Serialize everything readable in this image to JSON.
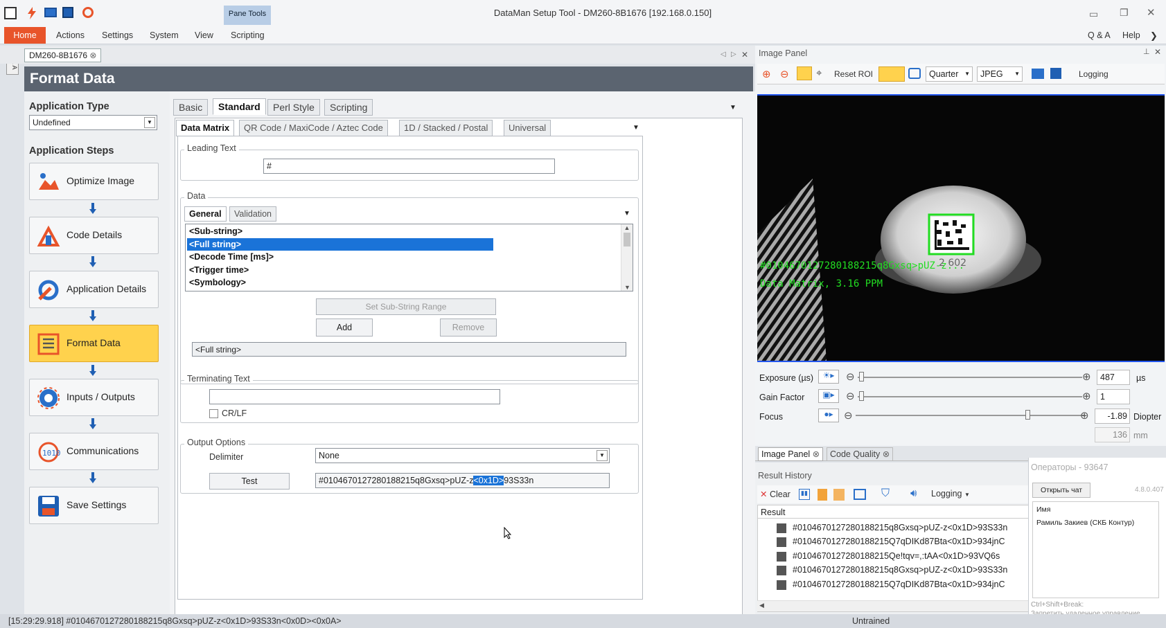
{
  "window": {
    "title": "DataMan Setup Tool - DM260-8B1676 [192.168.0.150]",
    "pane_tools": "Pane Tools"
  },
  "menu": [
    "Home",
    "Actions",
    "Settings",
    "System",
    "View",
    "Scripting"
  ],
  "menu_right": {
    "qa": "Q & A",
    "help": "Help"
  },
  "side_strip": "Q & A",
  "doc_tab": "DM260-8B1676",
  "page_title": "Format Data",
  "application_type": {
    "label": "Application Type",
    "value": "Undefined"
  },
  "application_steps": {
    "label": "Application Steps",
    "steps": [
      "Optimize Image",
      "Code Details",
      "Application Details",
      "Format Data",
      "Inputs / Outputs",
      "Communications",
      "Save Settings"
    ]
  },
  "tabs": [
    "Basic",
    "Standard",
    "Perl Style",
    "Scripting"
  ],
  "subtabs": [
    "Data Matrix",
    "QR Code / MaxiCode / Aztec Code",
    "1D / Stacked / Postal",
    "Universal"
  ],
  "leading_text": {
    "label": "Leading Text",
    "value": "#"
  },
  "data": {
    "label": "Data",
    "tabs": [
      "General",
      "Validation"
    ],
    "items": [
      "<Sub-string>",
      "<Full string>",
      "<Decode Time [ms]>",
      "<Trigger time>",
      "<Symbology>"
    ],
    "set_range": "Set Sub-String Range",
    "add": "Add",
    "remove": "Remove",
    "output": "<Full string>"
  },
  "terminating_text": {
    "label": "Terminating Text",
    "value": "",
    "crlf": "CR/LF"
  },
  "output_options": {
    "label": "Output Options",
    "delimiter_label": "Delimiter",
    "delimiter": "None",
    "test": "Test",
    "result_pre": "#0104670127280188215q8Gxsq>pUZ-z",
    "result_sel": "<0x1D>",
    "result_post": "93S33n"
  },
  "image_panel": {
    "title": "Image Panel",
    "reset_roi": "Reset ROI",
    "quarter": "Quarter",
    "jpeg": "JPEG",
    "logging": "Logging",
    "overlay_code": "#0104670127280188215q8Gxsq>pUZ-z...",
    "overlay_info": "Data Matrix, 3.16 PPM",
    "can_text": "2 602"
  },
  "exposure": {
    "label": "Exposure (µs)",
    "value": "487",
    "unit": "µs"
  },
  "gain": {
    "label": "Gain Factor",
    "value": "1"
  },
  "focus": {
    "label": "Focus",
    "value": "-1.89",
    "unit": "Diopter",
    "value2": "136",
    "unit2": "mm"
  },
  "bottom_tabs": [
    "Image Panel",
    "Code Quality"
  ],
  "result_history": {
    "title": "Result History",
    "clear": "Clear",
    "logging": "Logging",
    "column": "Result",
    "rows": [
      "#0104670127280188215q8Gxsq>pUZ-z<0x1D>93S33n",
      "#0104670127280188215Q7qDIKd87Bta<0x1D>934jnC",
      "#0104670127280188215Qe!tqv=,:tAA<0x1D>93VQ6s",
      "#0104670127280188215q8Gxsq>pUZ-z<0x1D>93S33n",
      "#0104670127280188215Q7qDIKd87Bta<0x1D>934jnC"
    ]
  },
  "chat": {
    "header": "Операторы - 93647",
    "open": "Открыть чат",
    "version": "4.8.0.407",
    "name_label": "Имя",
    "name": "Рамиль Закиев (СКБ Контур)",
    "hint1": "Ctrl+Shift+Break:",
    "hint2": "Запретить удаленное управление"
  },
  "status": {
    "log": "[15:29:29.918] #0104670127280188215q8Gxsq>pUZ-z<0x1D>93S33n<0x0D><0x0A>",
    "state": "Untrained"
  },
  "colors": {
    "home_tab": "#e8542a",
    "active_step": "#ffd24d",
    "selection": "#1a73d8",
    "overlay_green": "#22dd22"
  }
}
